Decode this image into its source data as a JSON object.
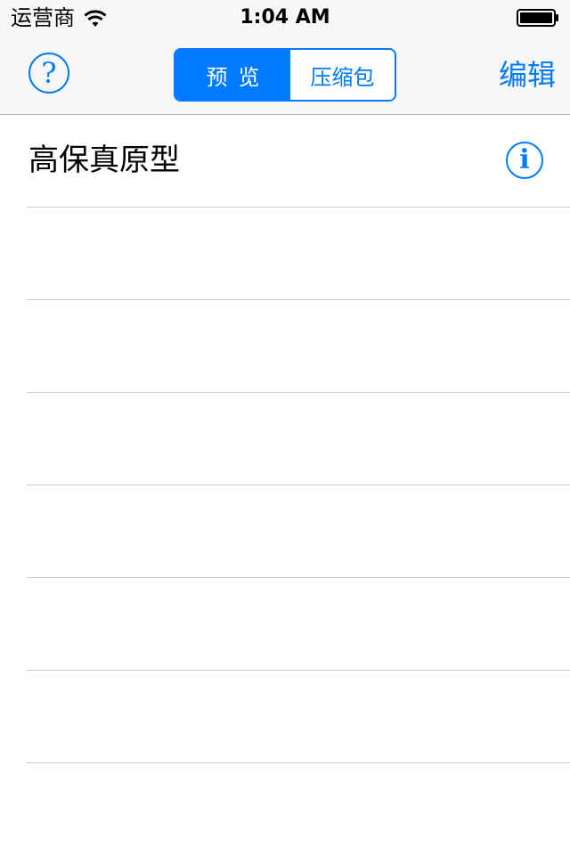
{
  "status_bar": {
    "carrier": "运营商",
    "time": "1:04 AM",
    "wifi_icon": "wifi-icon",
    "battery_icon": "battery-icon"
  },
  "nav_bar": {
    "help_icon_glyph": "?",
    "segments": [
      {
        "label": "预览",
        "selected": true
      },
      {
        "label": "压缩包",
        "selected": false
      }
    ],
    "edit_label": "编辑"
  },
  "list": {
    "rows": [
      {
        "title": "高保真原型",
        "info_icon_glyph": "i"
      },
      {
        "title": ""
      },
      {
        "title": ""
      },
      {
        "title": ""
      },
      {
        "title": ""
      },
      {
        "title": ""
      },
      {
        "title": ""
      },
      {
        "title": ""
      },
      {
        "title": ""
      }
    ]
  },
  "colors": {
    "accent": "#007aff",
    "bar_background": "#f7f7f7",
    "separator": "#c8c7cc"
  }
}
